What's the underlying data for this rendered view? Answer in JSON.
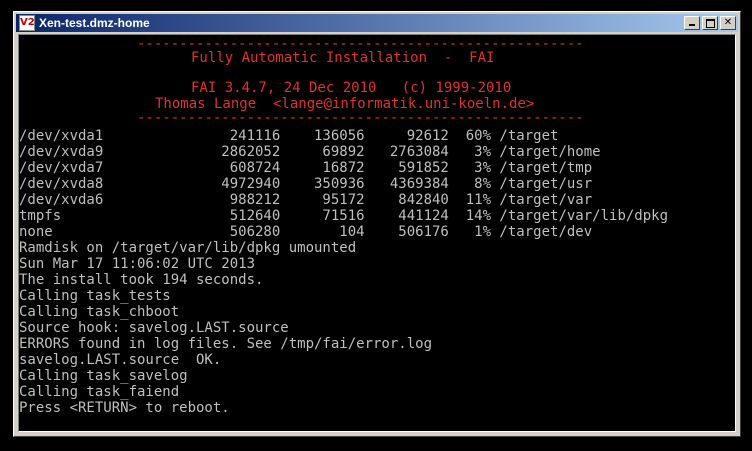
{
  "window": {
    "title": "Xen-test.dmz-home",
    "icon": "vnc-viewer-icon"
  },
  "console": {
    "header": [
      "-----------------------------------------------------",
      "Fully Automatic Installation  -  FAI",
      "FAI 3.4.7, 24 Dec 2010   (c) 1999-2010",
      "Thomas Lange  <lange@informatik.uni-koeln.de>",
      "-----------------------------------------------------"
    ],
    "df": [
      "/dev/xvda1               241116    136056     92612  60% /target",
      "/dev/xvda9              2862052     69892   2763084   3% /target/home",
      "/dev/xvda7               608724     16872    591852   3% /target/tmp",
      "/dev/xvda8              4972940    350936   4369384   8% /target/usr",
      "/dev/xvda6               988212     95172    842840  11% /target/var",
      "tmpfs                    512640     71516    441124  14% /target/var/lib/dpkg",
      "none                     506280       104    506176   1% /target/dev"
    ],
    "log": [
      "Ramdisk on /target/var/lib/dpkg umounted",
      "Sun Mar 17 11:06:02 UTC 2013",
      "The install took 194 seconds.",
      "Calling task_tests",
      "Calling task_chboot",
      "Source hook: savelog.LAST.source",
      "ERRORS found in log files. See /tmp/fai/error.log",
      "savelog.LAST.source  OK.",
      "Calling task_savelog",
      "Calling task_faiend",
      "Press <RETURN> to reboot."
    ]
  },
  "colors": {
    "console_bg": "#000000",
    "console_fg": "#bfbfbf",
    "header_fg": "#e03030",
    "titlebar_start": "#0a246a",
    "titlebar_end": "#a6caf0"
  }
}
